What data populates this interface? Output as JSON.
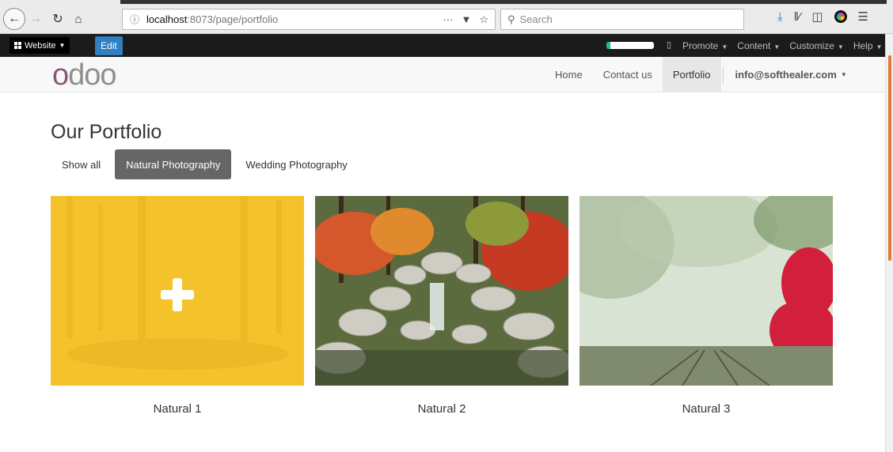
{
  "browser": {
    "back_icon": "back-arrow-icon",
    "forward_icon": "forward-arrow-icon",
    "reload_icon": "reload-icon",
    "home_icon": "home-icon",
    "url_host": "localhost",
    "url_rest": ":8073/page/portfolio",
    "url_more": "···",
    "search_placeholder": "Search"
  },
  "editor_bar": {
    "website_label": "Website",
    "edit_label": "Edit",
    "progress_percent": 8,
    "menus": [
      {
        "label": "Promote"
      },
      {
        "label": "Content"
      },
      {
        "label": "Customize"
      },
      {
        "label": "Help"
      }
    ],
    "colors": {
      "edit": "#2f7fc1",
      "progress": "#21b799"
    }
  },
  "site": {
    "logo_first": "o",
    "logo_rest": "doo",
    "nav": [
      {
        "label": "Home"
      },
      {
        "label": "Contact us"
      },
      {
        "label": "Portfolio",
        "active": true
      }
    ],
    "user": "info@softhealer.com",
    "colors": {
      "brand": "#875a7b"
    }
  },
  "page": {
    "title": "Our Portfolio",
    "filters": [
      {
        "label": "Show all"
      },
      {
        "label": "Natural Photography",
        "active": true
      },
      {
        "label": "Wedding Photography"
      }
    ],
    "items": [
      {
        "caption": "Natural 1",
        "image": "yellow-forest-overlay",
        "hovered": true
      },
      {
        "caption": "Natural 2",
        "image": "waterfall-autumn"
      },
      {
        "caption": "Natural 3",
        "image": "misty-rail-tracks"
      }
    ],
    "colors": {
      "overlay": "#f4c22b",
      "active_filter": "#666666"
    }
  }
}
